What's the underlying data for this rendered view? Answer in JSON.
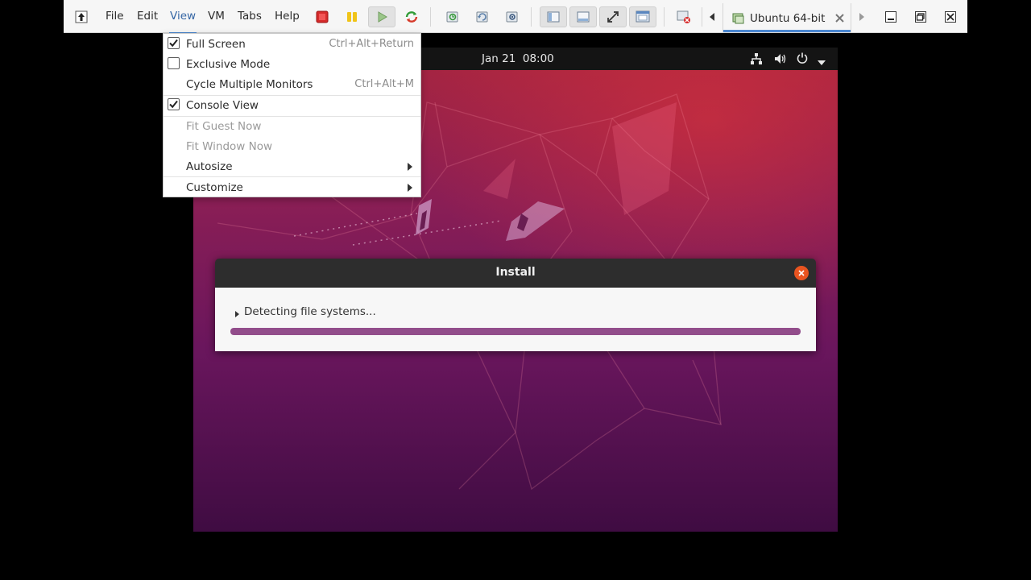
{
  "menubar": {
    "items": [
      "File",
      "Edit",
      "View",
      "VM",
      "Tabs",
      "Help"
    ],
    "active": "View"
  },
  "tab": {
    "label": "Ubuntu 64-bit"
  },
  "view_menu": {
    "full_screen": {
      "label": "Full Screen",
      "accel": "Ctrl+Alt+Return",
      "checked": true
    },
    "exclusive_mode": {
      "label": "Exclusive Mode",
      "checked": false
    },
    "cycle_monitors": {
      "label": "Cycle Multiple Monitors",
      "accel": "Ctrl+Alt+M"
    },
    "console_view": {
      "label": "Console View",
      "checked": true
    },
    "fit_guest": {
      "label": "Fit Guest Now",
      "disabled": true
    },
    "fit_window": {
      "label": "Fit Window Now",
      "disabled": true
    },
    "autosize": {
      "label": "Autosize",
      "submenu": true
    },
    "customize": {
      "label": "Customize",
      "submenu": true
    }
  },
  "guest": {
    "clock": "Jan 21  08:00",
    "tray_icons": [
      "network-icon",
      "volume-icon",
      "power-icon",
      "dropdown-arrow-icon"
    ]
  },
  "install_dialog": {
    "title": "Install",
    "status": "Detecting file systems...",
    "progress": 1.0
  },
  "colors": {
    "accent_blue": "#4a86cf",
    "ubuntu_orange": "#e95420",
    "progress_purple": "#924d8b"
  }
}
